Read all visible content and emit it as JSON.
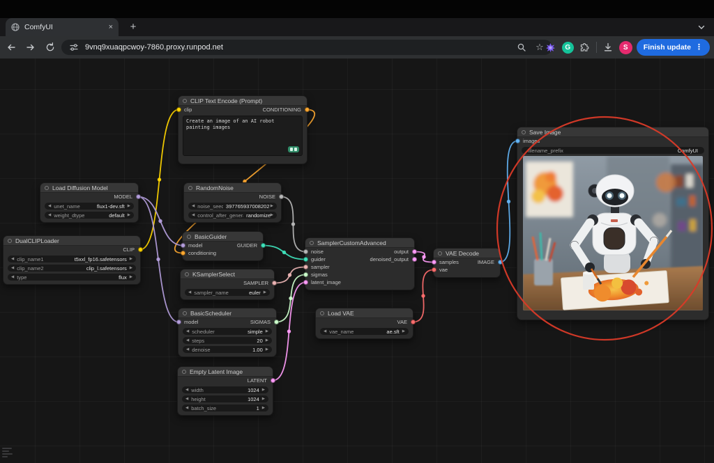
{
  "browser": {
    "tab_title": "ComfyUI",
    "url": "9vnq9xuaqpcwoy-7860.proxy.runpod.net",
    "update_label": "Finish update",
    "avatar_letter": "S",
    "grammarly_letter": "G"
  },
  "ui": {
    "widget_arrow_left": "◀",
    "widget_arrow_right": "▶",
    "new_tab_plus": "+",
    "tab_close": "×",
    "menu_dots": "⋮",
    "bookmark_star": "☆"
  },
  "type_colors": {
    "MODEL": "#B39DDB",
    "CLIP": "#FFD500",
    "CONDITIONING": "#FFA931",
    "NOISE": "#B8B8B8",
    "GUIDER": "#3FE3BC",
    "SAMPLER": "#ECB4B4",
    "SIGMAS": "#CDFFCD",
    "LATENT": "#FF9CF9",
    "IMAGE": "#64B5F6",
    "VAE": "#FF6E6E"
  },
  "annotation": {
    "shape": "ellipse",
    "color": "#D93A28"
  },
  "graph": {
    "nodes": [
      {
        "id": "clip_text_encode",
        "title": "CLIP Text Encode (Prompt)",
        "inputs": [
          {
            "name": "clip",
            "type": "CLIP"
          }
        ],
        "outputs": [
          {
            "name": "CONDITIONING",
            "type": "CONDITIONING"
          }
        ],
        "text": "Create an image of an AI robot painting images",
        "badge": true
      },
      {
        "id": "load_diffusion_model",
        "title": "Load Diffusion Model",
        "outputs": [
          {
            "name": "MODEL",
            "type": "MODEL"
          }
        ],
        "widgets": [
          {
            "label": "unet_name",
            "value": "flux1-dev.sft"
          },
          {
            "label": "weight_dtype",
            "value": "default"
          }
        ]
      },
      {
        "id": "dual_clip_loader",
        "title": "DualCLIPLoader",
        "outputs": [
          {
            "name": "CLIP",
            "type": "CLIP"
          }
        ],
        "widgets": [
          {
            "label": "clip_name1",
            "value": "t5xxl_fp16.safetensors"
          },
          {
            "label": "clip_name2",
            "value": "clip_l.safetensors"
          },
          {
            "label": "type",
            "value": "flux"
          }
        ]
      },
      {
        "id": "random_noise",
        "title": "RandomNoise",
        "outputs": [
          {
            "name": "NOISE",
            "type": "NOISE"
          }
        ],
        "widgets": [
          {
            "label": "noise_seed",
            "value": "397765937008202"
          },
          {
            "label": "control_after_generate",
            "value": "randomize"
          }
        ]
      },
      {
        "id": "basic_guider",
        "title": "BasicGuider",
        "inputs": [
          {
            "name": "model",
            "type": "MODEL"
          },
          {
            "name": "conditioning",
            "type": "CONDITIONING"
          }
        ],
        "outputs": [
          {
            "name": "GUIDER",
            "type": "GUIDER"
          }
        ]
      },
      {
        "id": "ksampler_select",
        "title": "KSamplerSelect",
        "outputs": [
          {
            "name": "SAMPLER",
            "type": "SAMPLER"
          }
        ],
        "widgets": [
          {
            "label": "sampler_name",
            "value": "euler"
          }
        ]
      },
      {
        "id": "basic_scheduler",
        "title": "BasicScheduler",
        "inputs": [
          {
            "name": "model",
            "type": "MODEL"
          }
        ],
        "outputs": [
          {
            "name": "SIGMAS",
            "type": "SIGMAS"
          }
        ],
        "widgets": [
          {
            "label": "scheduler",
            "value": "simple"
          },
          {
            "label": "steps",
            "value": "20"
          },
          {
            "label": "denoise",
            "value": "1.00"
          }
        ]
      },
      {
        "id": "empty_latent",
        "title": "Empty Latent Image",
        "outputs": [
          {
            "name": "LATENT",
            "type": "LATENT"
          }
        ],
        "widgets": [
          {
            "label": "width",
            "value": "1024"
          },
          {
            "label": "height",
            "value": "1024"
          },
          {
            "label": "batch_size",
            "value": "1"
          }
        ]
      },
      {
        "id": "sampler_custom",
        "title": "SamplerCustomAdvanced",
        "inputs": [
          {
            "name": "noise",
            "type": "NOISE"
          },
          {
            "name": "guider",
            "type": "GUIDER"
          },
          {
            "name": "sampler",
            "type": "SAMPLER"
          },
          {
            "name": "sigmas",
            "type": "SIGMAS"
          },
          {
            "name": "latent_image",
            "type": "LATENT"
          }
        ],
        "outputs": [
          {
            "name": "output",
            "type": "LATENT"
          },
          {
            "name": "denoised_output",
            "type": "LATENT"
          }
        ]
      },
      {
        "id": "load_vae",
        "title": "Load VAE",
        "outputs": [
          {
            "name": "VAE",
            "type": "VAE"
          }
        ],
        "widgets": [
          {
            "label": "vae_name",
            "value": "ae.sft"
          }
        ]
      },
      {
        "id": "vae_decode",
        "title": "VAE Decode",
        "inputs": [
          {
            "name": "samples",
            "type": "LATENT"
          },
          {
            "name": "vae",
            "type": "VAE"
          }
        ],
        "outputs": [
          {
            "name": "IMAGE",
            "type": "IMAGE"
          }
        ]
      },
      {
        "id": "save_image",
        "title": "Save Image",
        "inputs": [
          {
            "name": "images",
            "type": "IMAGE"
          }
        ],
        "widgets": [
          {
            "label": "filename_prefix",
            "value": "ComfyUI",
            "arrows": false
          }
        ],
        "image_alt": "AI robot painting an orange abstract artwork at a desk"
      }
    ]
  }
}
